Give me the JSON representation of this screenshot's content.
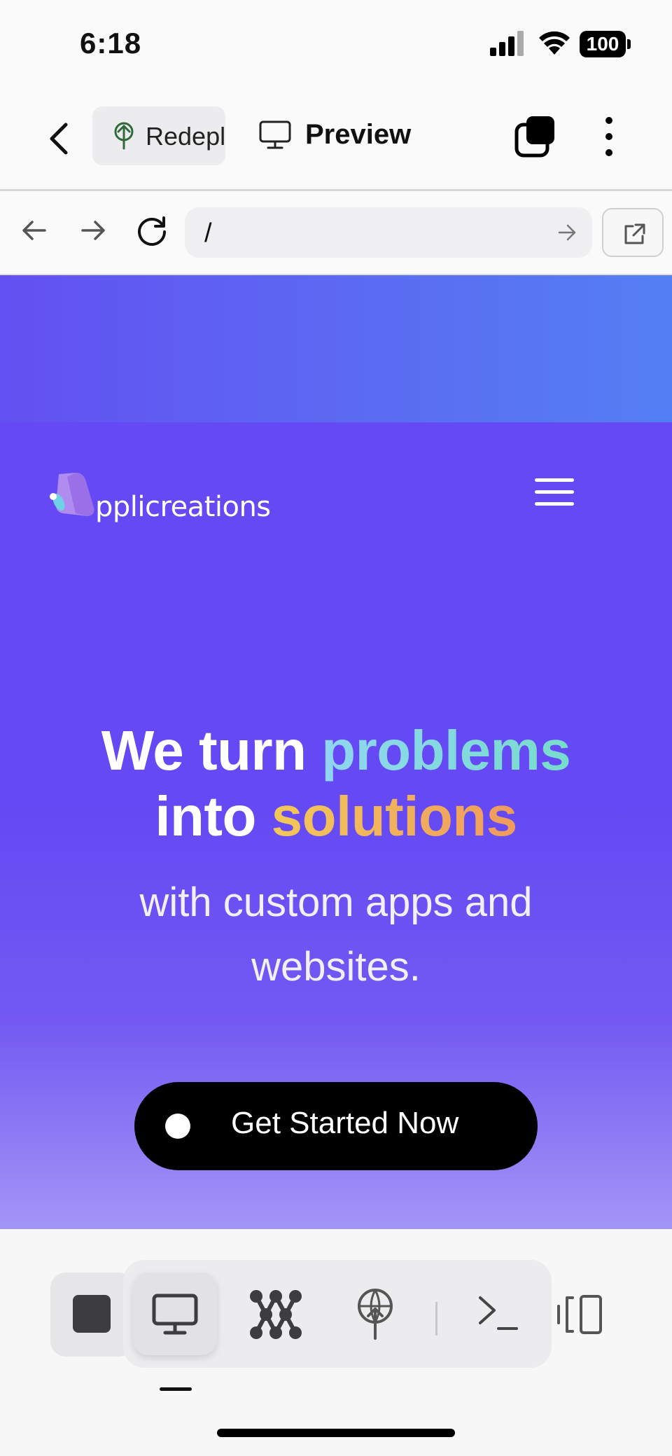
{
  "status_bar": {
    "time": "6:18",
    "battery": "100"
  },
  "toolbar": {
    "redeploy_label": "Redeploy",
    "preview_label": "Preview"
  },
  "address_bar": {
    "path": "/"
  },
  "site": {
    "logo_text": "pplicreations",
    "headline": {
      "part1": "We turn ",
      "highlight1": "problems",
      "part2": "into ",
      "highlight2": "solutions"
    },
    "subline": "with custom apps and websites.",
    "cta_label": "Get Started Now",
    "colors": {
      "background": "#6449f4",
      "highlight_problems": "#80d8e0",
      "highlight_solutions": "#f0b85c",
      "cta_background": "#000000"
    }
  },
  "bottom_toolbar": {
    "icons": [
      "stop-icon",
      "monitor-icon",
      "graph-nodes-icon",
      "deploy-tree-icon",
      "terminal-icon",
      "layout-panels-icon"
    ],
    "active": "monitor-icon"
  }
}
